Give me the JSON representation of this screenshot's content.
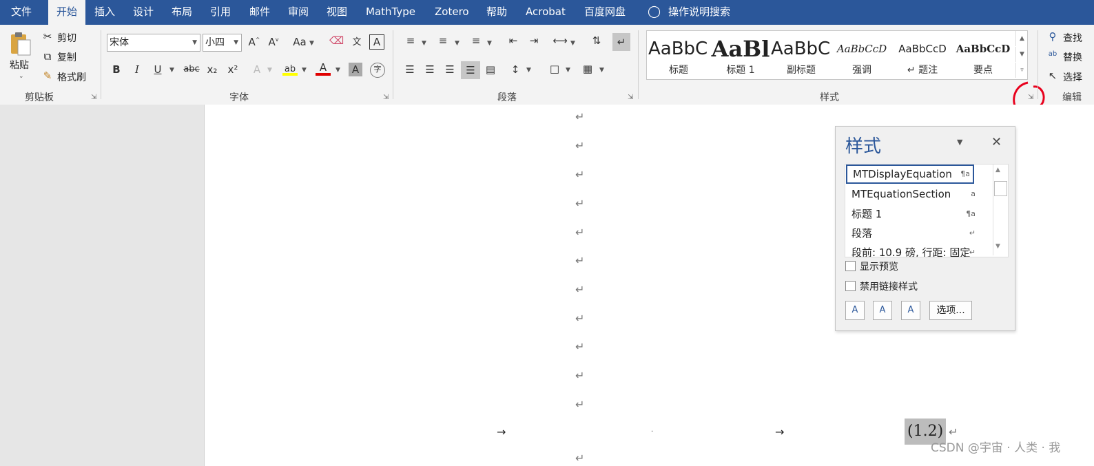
{
  "menubar": {
    "tabs": [
      "文件",
      "开始",
      "插入",
      "设计",
      "布局",
      "引用",
      "邮件",
      "审阅",
      "视图",
      "MathType",
      "Zotero",
      "帮助",
      "Acrobat",
      "百度网盘"
    ],
    "active_tab": "开始",
    "tell_me": "操作说明搜索"
  },
  "clipboard": {
    "paste": "粘贴",
    "cut": "剪切",
    "copy": "复制",
    "format_painter": "格式刷",
    "group": "剪贴板"
  },
  "font": {
    "font_name": "宋体",
    "font_size": "小四",
    "change_case": "Aa",
    "bold": "B",
    "italic": "I",
    "underline": "U",
    "strike": "abc",
    "subscript": "x₂",
    "superscript": "x²",
    "group": "字体"
  },
  "paragraph": {
    "group": "段落"
  },
  "styles": {
    "group": "样式",
    "gallery": [
      {
        "preview": "AaBbC(",
        "name": "标题"
      },
      {
        "preview": "AaBl",
        "name": "标题 1"
      },
      {
        "preview": "AaBbC(",
        "name": "副标题"
      },
      {
        "preview": "AaBbCcD",
        "name": "强调"
      },
      {
        "preview": "AaBbCcD",
        "name": "↵ 题注"
      },
      {
        "preview": "AaBbCcD",
        "name": "要点"
      }
    ]
  },
  "editing": {
    "find": "查找",
    "replace": "替换",
    "select": "选择",
    "group": "编辑"
  },
  "document": {
    "para_mark": "↵",
    "tab_arrow": "→",
    "equation_number": "(1.2)"
  },
  "styles_pane": {
    "title": "样式",
    "items": [
      {
        "name": "MTDisplayEquation",
        "glyph": "¶a"
      },
      {
        "name": "MTEquationSection",
        "glyph": "a"
      },
      {
        "name": "标题 1",
        "glyph": "¶a"
      },
      {
        "name": "段落",
        "glyph": "↵"
      },
      {
        "name": "段前: 10.9 磅, 行距: 固定",
        "glyph": "↵"
      }
    ],
    "show_preview": "显示预览",
    "disable_linked": "禁用链接样式",
    "options_button": "选项..."
  },
  "watermark": "CSDN @宇宙 · 人类 · 我",
  "colors": {
    "accent": "#2b579a",
    "highlight": "#ffff00",
    "font_color": "#e00000",
    "annotation": "#e8001c"
  }
}
